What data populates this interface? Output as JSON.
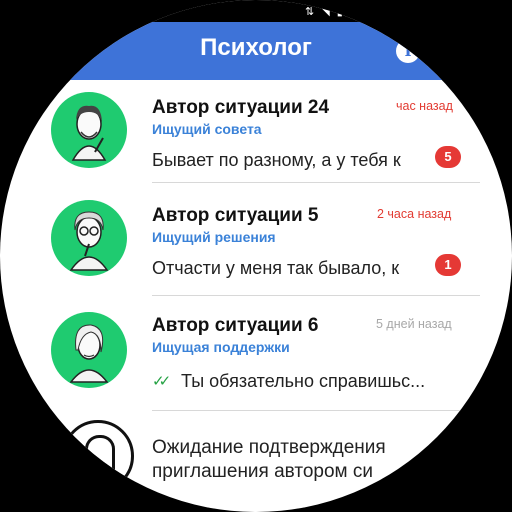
{
  "header": {
    "title": "Психолог",
    "info_icon": "info-icon"
  },
  "chats": [
    {
      "name": "Автор ситуации 24",
      "role": "Ищущий совета",
      "time": "час назад",
      "time_color": "red",
      "message": "Бывает по разному, а у тебя к",
      "unread": "5",
      "avatar": "man-portrait-avatar"
    },
    {
      "name": "Автор ситуации 5",
      "role": "Ищущий решения",
      "time": "2 часа назад",
      "time_color": "red",
      "message": "Отчасти у меня так бывало, к",
      "unread": "1",
      "avatar": "woman-glasses-avatar"
    },
    {
      "name": "Автор ситуации 6",
      "role": "Ищущая поддержки",
      "time": "5 дней назад",
      "time_color": "grey",
      "message": "Ты обязательно справишьс...",
      "read_status": "double-check-icon",
      "avatar": "woman-avatar"
    }
  ],
  "pending": {
    "text_line1": "Ожидание подтверждения",
    "text_line2": "приглашения автором си"
  },
  "colors": {
    "accent": "#3e73d8",
    "avatar_bg": "#1fcb70",
    "badge": "#e53935",
    "role": "#3b82d8"
  }
}
